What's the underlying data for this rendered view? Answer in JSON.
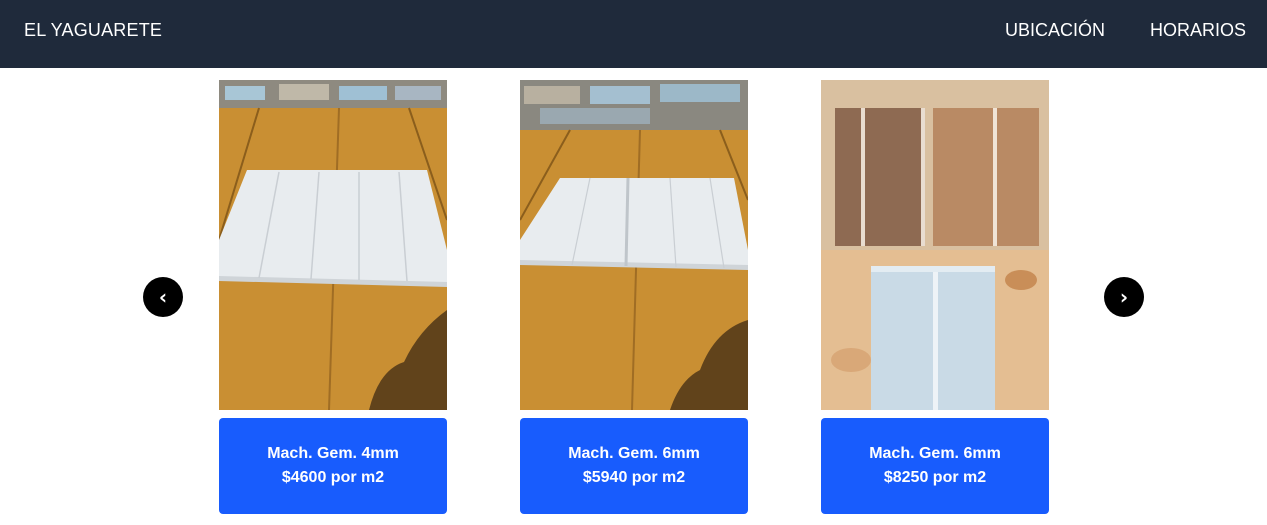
{
  "navbar": {
    "brand": "EL YAGUARETE",
    "links": [
      "UBICACIÓN",
      "HORARIOS"
    ]
  },
  "carousel": {
    "prev_label": "‹",
    "next_label": "›",
    "products": [
      {
        "name": "Mach. Gem. 4mm",
        "price": "$4600 por m2",
        "photo": "white-pvc-panel-on-wood"
      },
      {
        "name": "Mach. Gem. 6mm",
        "price": "$5940 por m2",
        "photo": "white-pvc-panels-on-wood"
      },
      {
        "name": "Mach. Gem. 6mm",
        "price": "$8250 por m2",
        "photo": "wood-and-white-panel-samples"
      }
    ]
  }
}
